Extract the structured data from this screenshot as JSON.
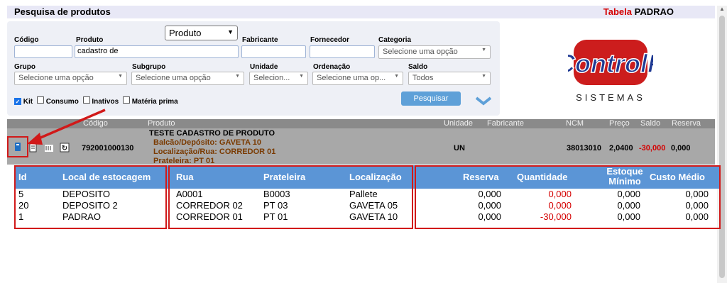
{
  "header": {
    "title": "Pesquisa de produtos",
    "tabela_label": "Tabela",
    "tabela_value": "PADRAO"
  },
  "filters": {
    "mode_select": "Produto",
    "codigo": {
      "label": "Código",
      "value": ""
    },
    "produto": {
      "label": "Produto",
      "value": "cadastro de"
    },
    "fabricante": {
      "label": "Fabricante",
      "value": ""
    },
    "fornecedor": {
      "label": "Fornecedor",
      "value": ""
    },
    "categoria": {
      "label": "Categoria",
      "value": "Selecione uma opção"
    },
    "grupo": {
      "label": "Grupo",
      "value": "Selecione uma opção"
    },
    "subgrupo": {
      "label": "Subgrupo",
      "value": "Selecione uma opção"
    },
    "unidade": {
      "label": "Unidade",
      "value": "Selecion..."
    },
    "ordenacao": {
      "label": "Ordenação",
      "value": "Selecione uma op..."
    },
    "saldo": {
      "label": "Saldo",
      "value": "Todos"
    },
    "checkboxes": [
      {
        "label": "Kit",
        "checked": true
      },
      {
        "label": "Consumo",
        "checked": false
      },
      {
        "label": "Inativos",
        "checked": false
      },
      {
        "label": "Matéria prima",
        "checked": false
      }
    ],
    "search_button": "Pesquisar"
  },
  "logo": {
    "text": "ControlP",
    "subtext": "SISTEMAS"
  },
  "product": {
    "headers": {
      "codigo": "Código",
      "produto": "Produto",
      "unidade": "Unidade",
      "fabricante": "Fabricante",
      "ncm": "NCM",
      "preco": "Preço",
      "saldo": "Saldo",
      "reserva": "Reserva"
    },
    "codigo": "792001000130",
    "name": "TESTE CADASTRO DE PRODUTO",
    "balcao": "Balcão/Depósito: GAVETA 10",
    "localizacao": "Localização/Rua: CORREDOR 01",
    "prateleira": "Prateleira: PT 01",
    "unidade": "UN",
    "ncm": "38013010",
    "preco": "2,0400",
    "saldo": "-30,000",
    "reserva": "0,000"
  },
  "stock_table": {
    "columns": [
      "Id",
      "Local de estocagem",
      "Rua",
      "Prateleira",
      "Localização",
      "Reserva",
      "Quantidade",
      "Estoque Mínimo",
      "Custo Médio"
    ],
    "col_estoque_1": "Estoque",
    "col_estoque_2": "Mínimo",
    "rows": [
      {
        "id": "5",
        "local": "DEPOSITO",
        "rua": "A0001",
        "prateleira": "B0003",
        "localizacao": "Pallete",
        "reserva": "0,000",
        "quantidade": "0,000",
        "estoque_minimo": "0,000",
        "custo_medio": "0,000"
      },
      {
        "id": "20",
        "local": "DEPOSITO 2",
        "rua": "CORREDOR 02",
        "prateleira": "PT 03",
        "localizacao": "GAVETA 05",
        "reserva": "0,000",
        "quantidade": "0,000",
        "estoque_minimo": "0,000",
        "custo_medio": "0,000"
      },
      {
        "id": "1",
        "local": "PADRAO",
        "rua": "CORREDOR 01",
        "prateleira": "PT 01",
        "localizacao": "GAVETA 10",
        "reserva": "0,000",
        "quantidade": "-30,000",
        "estoque_minimo": "0,000",
        "custo_medio": "0,000"
      }
    ]
  },
  "colors": {
    "accent": "#5b95d6",
    "red": "#d40000",
    "annotation": "#d11919"
  }
}
